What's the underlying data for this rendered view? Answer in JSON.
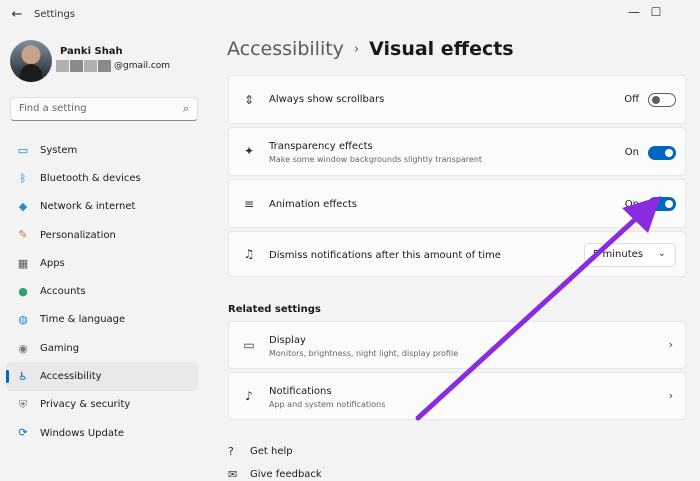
{
  "window": {
    "title": "Settings",
    "back_glyph": "←",
    "minimize_glyph": "—",
    "maximize_glyph": "☐"
  },
  "user": {
    "name": "Panki Shah",
    "email_suffix": "@gmail.com"
  },
  "search": {
    "placeholder": "Find a setting"
  },
  "nav": {
    "items": [
      {
        "label": "System",
        "icon": "system-icon",
        "glyph": "▭",
        "color": "#0078d4"
      },
      {
        "label": "Bluetooth & devices",
        "icon": "bluetooth-icon",
        "glyph": "ᛒ",
        "color": "#0078d4"
      },
      {
        "label": "Network & internet",
        "icon": "network-icon",
        "glyph": "◆",
        "color": "#2b88d8"
      },
      {
        "label": "Personalization",
        "icon": "brush-icon",
        "glyph": "✎",
        "color": "#c4763b"
      },
      {
        "label": "Apps",
        "icon": "apps-icon",
        "glyph": "▦",
        "color": "#555555"
      },
      {
        "label": "Accounts",
        "icon": "accounts-icon",
        "glyph": "●",
        "color": "#2ba36a"
      },
      {
        "label": "Time & language",
        "icon": "globe-icon",
        "glyph": "◍",
        "color": "#2b88d8"
      },
      {
        "label": "Gaming",
        "icon": "gaming-icon",
        "glyph": "◉",
        "color": "#777777"
      },
      {
        "label": "Accessibility",
        "icon": "accessibility-icon",
        "glyph": "♿",
        "color": "#0f6cbd"
      },
      {
        "label": "Privacy & security",
        "icon": "shield-icon",
        "glyph": "⛨",
        "color": "#777777"
      },
      {
        "label": "Windows Update",
        "icon": "update-icon",
        "glyph": "⟳",
        "color": "#0f6cbd"
      }
    ],
    "active_index": 8
  },
  "breadcrumb": {
    "parent": "Accessibility",
    "separator": "›",
    "current": "Visual effects"
  },
  "settings": [
    {
      "title": "Always show scrollbars",
      "subtitle": "",
      "state": "Off",
      "on": false,
      "icon": "scrollbar-icon",
      "glyph": "⇕"
    },
    {
      "title": "Transparency effects",
      "subtitle": "Make some window backgrounds slightly transparent",
      "state": "On",
      "on": true,
      "icon": "sparkle-icon",
      "glyph": "✦"
    },
    {
      "title": "Animation effects",
      "subtitle": "",
      "state": "On",
      "on": true,
      "icon": "animation-icon",
      "glyph": "≡"
    },
    {
      "title": "Dismiss notifications after this amount of time",
      "subtitle": "",
      "dropdown_value": "5 minutes",
      "icon": "bell-timer-icon",
      "glyph": "♫"
    }
  ],
  "related": {
    "heading": "Related settings",
    "items": [
      {
        "title": "Display",
        "subtitle": "Monitors, brightness, night light, display profile",
        "icon": "display-icon",
        "glyph": "▭"
      },
      {
        "title": "Notifications",
        "subtitle": "App and system notifications",
        "icon": "bell-icon",
        "glyph": "♪"
      }
    ]
  },
  "links": [
    {
      "label": "Get help",
      "icon": "help-icon",
      "glyph": "?"
    },
    {
      "label": "Give feedback",
      "icon": "feedback-icon",
      "glyph": "✉"
    }
  ],
  "chevron_glyph": "›",
  "dropdown_glyph": "⌄",
  "search_glyph": "⌕",
  "colors": {
    "accent": "#0067c0",
    "annotation_arrow": "#8a2be2"
  }
}
